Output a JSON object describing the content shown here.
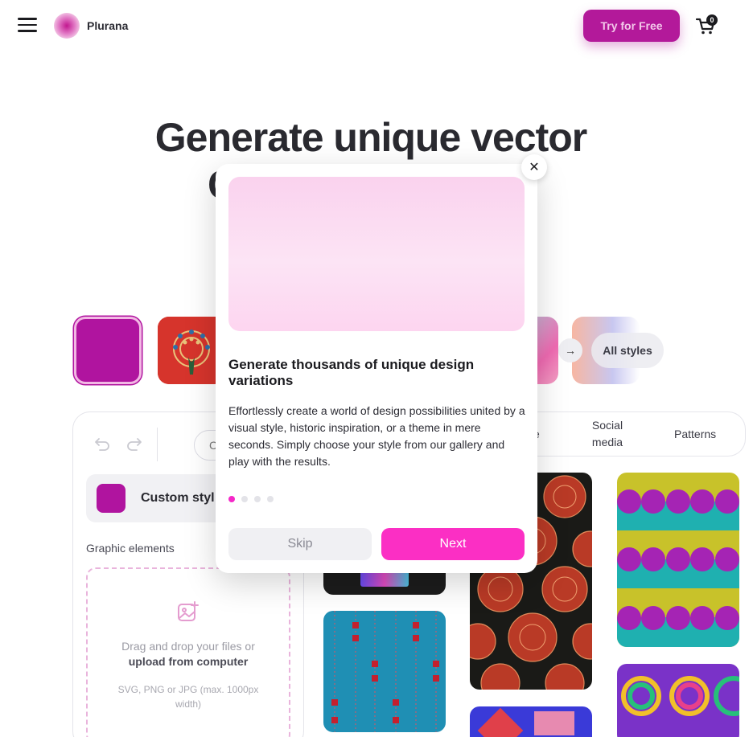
{
  "header": {
    "brand": "Plurana",
    "try_label": "Try for Free",
    "cart_count": "0",
    "icons": [
      "menu-icon",
      "logo-icon",
      "cart-icon"
    ]
  },
  "hero": {
    "title_line1": "Generate unique vector",
    "title_line2_visible": "C"
  },
  "styles": {
    "all_styles_label": "All styles",
    "arrow_icon": "arrow-right-icon"
  },
  "editor": {
    "input_visible": "C",
    "custom_style_label": "Custom styl",
    "graphic_elements_label": "Graphic elements",
    "drop_text": "Drag and drop your files or",
    "drop_link": "upload from computer",
    "drop_sub": "SVG, PNG or JPG (max. 1000px width)"
  },
  "tabs": {
    "partial": "e",
    "social_media": "Social media",
    "patterns": "Patterns"
  },
  "modal": {
    "title": "Generate thousands of unique design variations",
    "body": "Effortlessly create a world of design possibilities united by a visual style, historic inspiration, or a theme in mere seconds. Simply choose your style from our gallery and play with the results.",
    "step_count": 4,
    "active_step": 1,
    "skip_label": "Skip",
    "next_label": "Next",
    "close_icon": "close-icon"
  },
  "colors": {
    "accent": "#fb2fc4",
    "brand_magenta": "#b0149f",
    "try_button": "#b3199a"
  }
}
